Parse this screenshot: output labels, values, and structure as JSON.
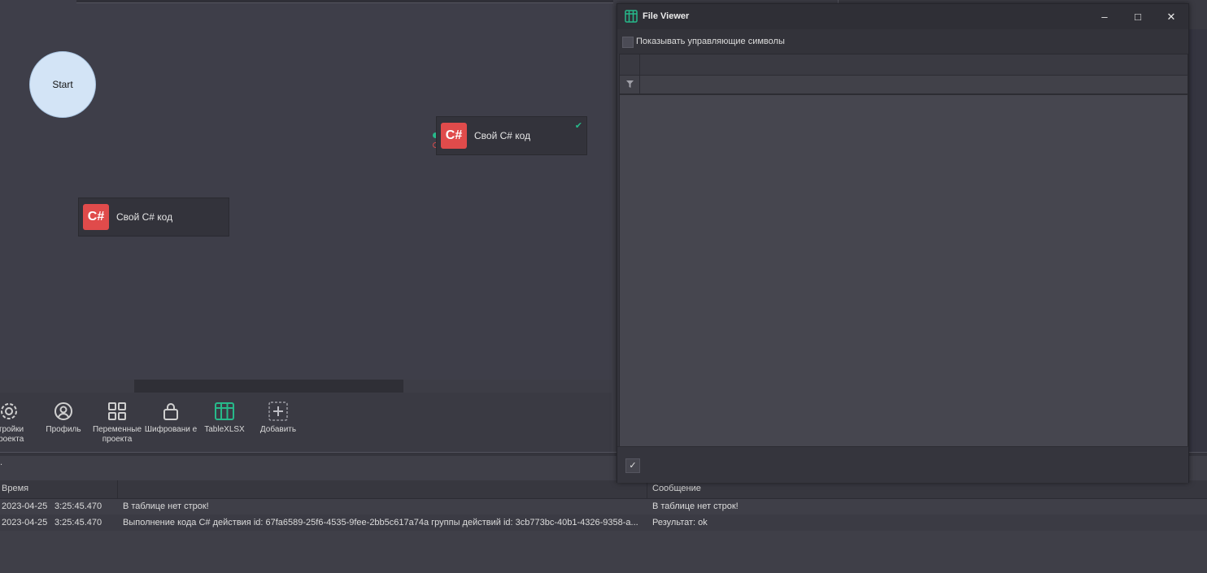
{
  "canvas": {
    "start_label": "Start",
    "node1": {
      "icon_text": "C#",
      "label": "Свой C# код",
      "status_icon": "check-icon"
    },
    "node2": {
      "icon_text": "C#",
      "label": "Свой C# код"
    }
  },
  "toolbar": {
    "items": [
      {
        "label": "стройки проекта",
        "icon": "gear-icon"
      },
      {
        "label": "Профиль",
        "icon": "user-icon"
      },
      {
        "label": "Переменные проекта",
        "icon": "grid-icon"
      },
      {
        "label": "Шифровани е",
        "icon": "lock-icon"
      },
      {
        "label": "TableXLSX",
        "icon": "table-icon"
      },
      {
        "label": "Добавить",
        "icon": "add-icon"
      }
    ]
  },
  "log": {
    "sep_marker": ".",
    "columns": {
      "time": "Время",
      "message": "Сообщение"
    },
    "rows": [
      {
        "date": "2023-04-25",
        "time": "3:25:45.470",
        "text": "В таблице нет строк!",
        "message": "В таблице нет строк!"
      },
      {
        "date": "2023-04-25",
        "time": "3:25:45.470",
        "text": "Выполнение кода C# действия id: 67fa6589-25f6-4535-9fee-2bb5c617a74a группы действий id: 3cb773bc-40b1-4326-9358-a...",
        "message": "Результат: ok"
      }
    ]
  },
  "file_viewer": {
    "title": "File Viewer",
    "icon": "table-icon",
    "checkbox_label": "Показывать управляющие символы",
    "window_buttons": {
      "minimize": "–",
      "maximize": "□",
      "close": "✕"
    },
    "ok_glyph": "✓"
  },
  "colors": {
    "accent_green": "#27b98a",
    "csharp_red": "#e04b4b",
    "start_fill": "#d3e4f6"
  }
}
